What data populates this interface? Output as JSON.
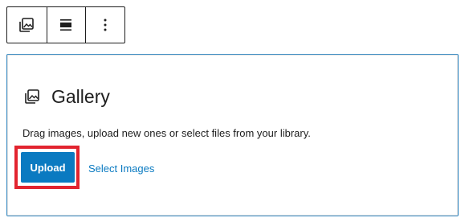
{
  "toolbar": {
    "items": [
      {
        "icon": "gallery-icon"
      },
      {
        "icon": "align-icon"
      },
      {
        "icon": "more-options-icon"
      }
    ]
  },
  "gallery_block": {
    "icon": "gallery-icon",
    "title": "Gallery",
    "instructions": "Drag images, upload new ones or select files from your library.",
    "upload_label": "Upload",
    "select_label": "Select Images"
  },
  "colors": {
    "accent": "#0a7ac1",
    "highlight": "#e2242f",
    "block_border": "#3c8dc4",
    "text": "#1e1e1e"
  }
}
